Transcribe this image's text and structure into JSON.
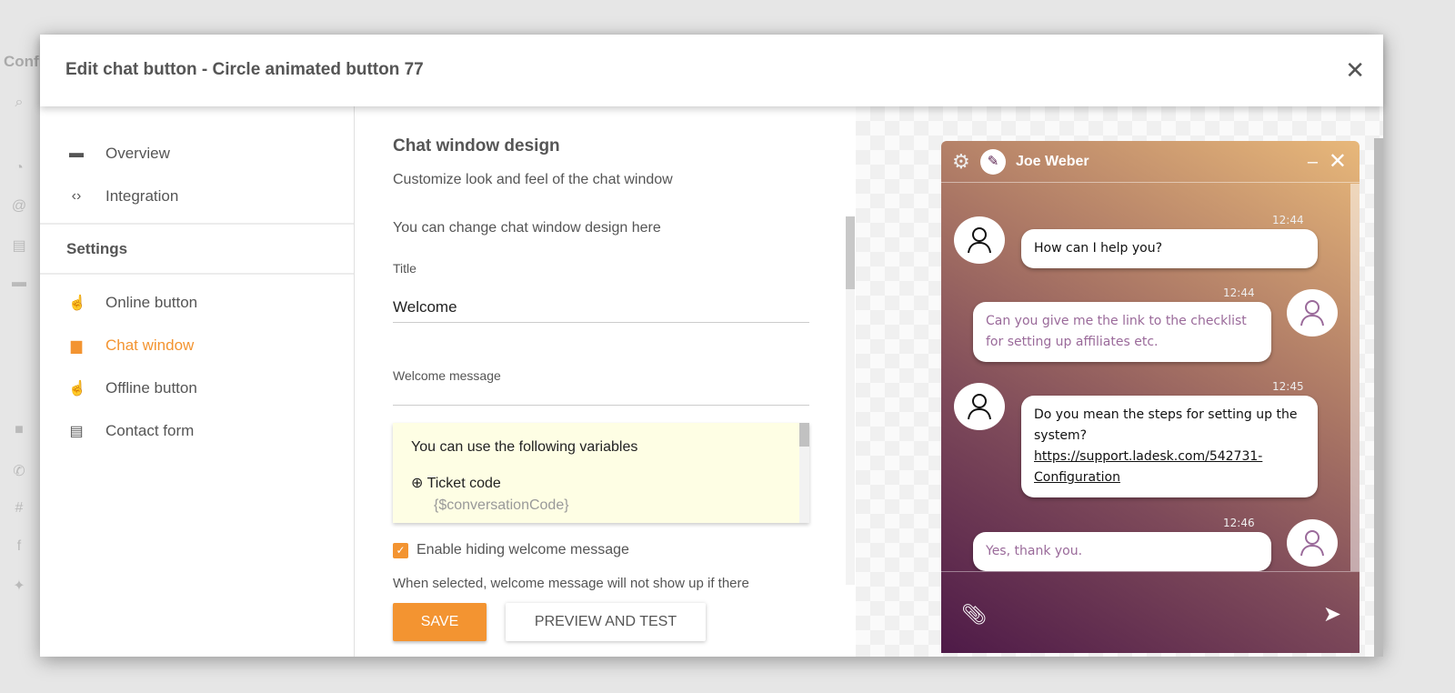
{
  "background": {
    "title": "Confi"
  },
  "modal": {
    "title": "Edit chat button - Circle animated button 77",
    "nav": {
      "items_top": [
        {
          "label": "Overview",
          "icon": "chat-bubble-icon"
        },
        {
          "label": "Integration",
          "icon": "code-icon"
        }
      ],
      "section": "Settings",
      "items": [
        {
          "label": "Online button",
          "icon": "hand-pointer-icon"
        },
        {
          "label": "Chat window",
          "icon": "chat-window-icon",
          "active": true
        },
        {
          "label": "Offline button",
          "icon": "hand-pointer-icon"
        },
        {
          "label": "Contact form",
          "icon": "form-icon"
        }
      ]
    },
    "form": {
      "heading": "Chat window design",
      "subheading": "Customize look and feel of the chat window",
      "note": "You can change chat window design here",
      "title_label": "Title",
      "title_value": "Welcome",
      "welcome_label": "Welcome message",
      "welcome_value": "",
      "variables": {
        "intro": "You can use the following variables",
        "items": [
          {
            "name": "Ticket code",
            "code": "{$conversationCode}"
          }
        ]
      },
      "hide_welcome": {
        "label": "Enable hiding welcome message",
        "checked": true
      },
      "hide_welcome_help": "When selected, welcome message will not show up if there",
      "save_label": "SAVE",
      "preview_label": "PREVIEW AND TEST"
    },
    "accent_color": "#f39431"
  },
  "chat": {
    "agent_name": "Joe Weber",
    "messages": [
      {
        "from": "agent",
        "time": "12:44",
        "text": "How can I help you?"
      },
      {
        "from": "visitor",
        "time": "12:44",
        "text": "Can you give me the link to the checklist for setting up affiliates etc."
      },
      {
        "from": "agent",
        "time": "12:45",
        "text": "Do you mean the steps for setting up the system?",
        "link": "https://support.ladesk.com/542731-Configuration"
      },
      {
        "from": "visitor",
        "time": "12:46",
        "text": "Yes, thank you."
      }
    ]
  }
}
